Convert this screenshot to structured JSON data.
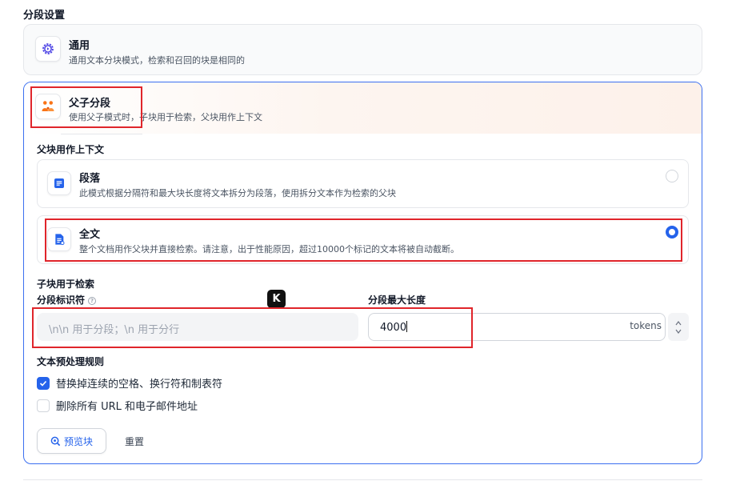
{
  "section_title": "分段设置",
  "general": {
    "title": "通用",
    "description": "通用文本分块模式，检索和召回的块是相同的",
    "icon": "gear-icon"
  },
  "parent_child": {
    "title": "父子分段",
    "description": "使用父子模式时，子块用于检索，父块用作上下文",
    "icon": "family-icon",
    "parent_label": "父块用作上下文",
    "options": [
      {
        "title": "段落",
        "description": "此模式根据分隔符和最大块长度将文本拆分为段落，使用拆分文本作为检索的父块",
        "selected": false,
        "icon": "document-lines-icon"
      },
      {
        "title": "全文",
        "description": "整个文档用作父块并直接检索。请注意，出于性能原因，超过10000个标记的文本将被自动截断。",
        "selected": true,
        "icon": "document-full-icon"
      }
    ],
    "child_label": "子块用于检索",
    "delimiter_label": "分段标识符",
    "delimiter_placeholder": "\\n\\n 用于分段；\\n 用于分行",
    "max_length_label": "分段最大长度",
    "max_length_value": "4000",
    "max_length_unit": "tokens",
    "preprocess_label": "文本预处理规则",
    "rules": [
      {
        "label": "替换掉连续的空格、换行符和制表符",
        "checked": true
      },
      {
        "label": "删除所有 URL 和电子邮件地址",
        "checked": false
      }
    ],
    "preview_button": "预览块",
    "reset_button": "重置"
  },
  "colors": {
    "accent": "#2563eb",
    "card_border_active": "#3b6ff0",
    "highlight_red": "#e0252b"
  }
}
